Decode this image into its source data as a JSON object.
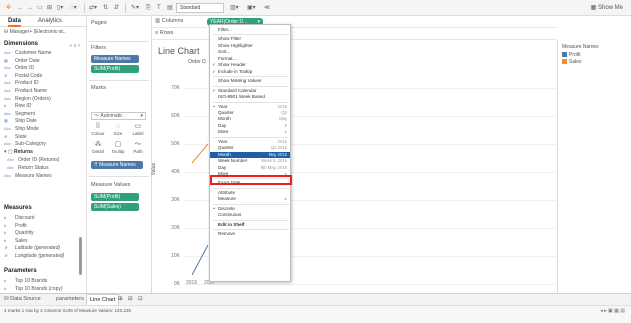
{
  "toolbar": {
    "select_value": "Standard",
    "show_me": "Show Me",
    "icons": [
      "tableau-logo-icon",
      "undo-icon",
      "redo-icon",
      "save-icon",
      "new-datasource-icon",
      "new-sheet-icon",
      "swap-icon",
      "sort-asc-icon",
      "sort-desc-icon",
      "highlight-icon",
      "group-icon",
      "label-icon",
      "fit-icon",
      "chart-icon",
      "share-icon",
      "show-me-icon"
    ]
  },
  "left_pane": {
    "tabs": [
      "Data",
      "Analytics"
    ],
    "datasource": "Manager+ (Electronic-st..",
    "dimensions_header": "Dimensions",
    "dimensions": [
      {
        "label": "Customer Name",
        "icon": "Abc"
      },
      {
        "label": "Order Date",
        "icon": "▦"
      },
      {
        "label": "Order ID",
        "icon": "Abc"
      },
      {
        "label": "Postal Code",
        "icon": "⊕"
      },
      {
        "label": "Product ID",
        "icon": "Abc"
      },
      {
        "label": "Product Name",
        "icon": "Abc"
      },
      {
        "label": "Region (Orders)",
        "icon": "Abc"
      },
      {
        "label": "Row ID",
        "icon": "#"
      },
      {
        "label": "Segment",
        "icon": "Abc"
      },
      {
        "label": "Ship Date",
        "icon": "▦"
      },
      {
        "label": "Ship Mode",
        "icon": "Abc"
      },
      {
        "label": "State",
        "icon": "⊕"
      },
      {
        "label": "Sub-Category",
        "icon": "Abc"
      }
    ],
    "returns_group": "Returns",
    "returns_fields": [
      {
        "label": "Order ID (Returns)",
        "icon": "Abc"
      },
      {
        "label": "Return Status",
        "icon": "Abc"
      }
    ],
    "measure_names": "Measure Names",
    "measures_header": "Measures",
    "measures": [
      {
        "label": "Discount",
        "icon": "#"
      },
      {
        "label": "Profit",
        "icon": "#"
      },
      {
        "label": "Quantity",
        "icon": "#"
      },
      {
        "label": "Sales",
        "icon": "#"
      },
      {
        "label": "Latitude (generated)",
        "icon": "⊕"
      },
      {
        "label": "Longitude (generated)",
        "icon": "⊕"
      }
    ],
    "parameters_header": "Parameters",
    "parameters": [
      {
        "label": "Top 10 Brands",
        "icon": "#"
      },
      {
        "label": "Top 10 Brands (copy)",
        "icon": "#"
      }
    ]
  },
  "cards": {
    "pages": "Pages",
    "filters": "Filters",
    "filter_pills": [
      "Measure Names",
      "SUM(Profit)"
    ],
    "marks": "Marks",
    "marks_type": "Automatic",
    "mark_buttons": [
      {
        "label": "Colour",
        "icon": "⠿"
      },
      {
        "label": "Size",
        "icon": "◌"
      },
      {
        "label": "Label",
        "icon": "▭"
      },
      {
        "label": "Detail",
        "icon": "⁂"
      },
      {
        "label": "Tooltip",
        "icon": "▢"
      },
      {
        "label": "Path",
        "icon": "〜"
      }
    ],
    "marks_pill": "Measure Names",
    "measure_values": "Measure Values",
    "mv_pills": [
      "SUM(Profit)",
      "SUM(Sales)"
    ]
  },
  "shelves": {
    "columns_label": "Columns",
    "columns_pill": "YEAR(Order D...",
    "rows_label": "Rows"
  },
  "view": {
    "title": "Line Chart",
    "column_header": "Order D",
    "y_axis_title": "Value",
    "y_ticks": [
      "70K",
      "60K",
      "50K",
      "40K",
      "30K",
      "20K",
      "10K",
      "0K"
    ],
    "x_ticks": [
      "2016",
      "2017"
    ]
  },
  "legend": {
    "title": "Measure Names",
    "items": [
      {
        "label": "Profit",
        "color": "#4e79a7"
      },
      {
        "label": "Sales",
        "color": "#f28e2b"
      }
    ]
  },
  "context_menu": {
    "items": [
      {
        "type": "item",
        "label": "Filter..."
      },
      {
        "type": "sep"
      },
      {
        "type": "item",
        "label": "Show Filter"
      },
      {
        "type": "item",
        "label": "Show Highlighter"
      },
      {
        "type": "item",
        "label": "Sort..."
      },
      {
        "type": "item",
        "label": "Format..."
      },
      {
        "type": "item",
        "label": "Show Header",
        "check": "✓"
      },
      {
        "type": "item",
        "label": "Include in Tooltip",
        "check": "✓"
      },
      {
        "type": "sep"
      },
      {
        "type": "item",
        "label": "Show Missing Values"
      },
      {
        "type": "sep"
      },
      {
        "type": "item",
        "label": "Standard Calendar",
        "check": "✓"
      },
      {
        "type": "item",
        "label": "ISO-8601 Week Based"
      },
      {
        "type": "sep"
      },
      {
        "type": "item",
        "label": "Year",
        "check": "•",
        "extra": "2015"
      },
      {
        "type": "item",
        "label": "Quarter",
        "extra": "Q2"
      },
      {
        "type": "item",
        "label": "Month",
        "extra": "May"
      },
      {
        "type": "item",
        "label": "Day",
        "extra": "8"
      },
      {
        "type": "item",
        "label": "More",
        "extra": "▸"
      },
      {
        "type": "sep"
      },
      {
        "type": "item",
        "label": "Year",
        "extra": "2015"
      },
      {
        "type": "item",
        "label": "Quarter",
        "extra": "Q2 2015"
      },
      {
        "type": "item",
        "label": "Month",
        "selected": true,
        "extra": "May 2015"
      },
      {
        "type": "item",
        "label": "Week Number",
        "extra": "Week 5, 2015"
      },
      {
        "type": "item",
        "label": "Day",
        "extra": "8th May, 2015"
      },
      {
        "type": "item",
        "label": "More",
        "extra": "▸"
      },
      {
        "type": "sep"
      },
      {
        "type": "item",
        "label": "Exact Date"
      },
      {
        "type": "sep"
      },
      {
        "type": "item",
        "label": "Attribute"
      },
      {
        "type": "item",
        "label": "Measure",
        "extra": "▸"
      },
      {
        "type": "sep"
      },
      {
        "type": "item",
        "label": "Discrete",
        "check": "•"
      },
      {
        "type": "item",
        "label": "Continuous"
      },
      {
        "type": "sep"
      },
      {
        "type": "item",
        "label": "Edit in Shelf",
        "bold": true
      },
      {
        "type": "sep"
      },
      {
        "type": "item",
        "label": "Remove"
      }
    ]
  },
  "bottom": {
    "data_source_tab": "Data Source",
    "sheet_tabs": [
      "parameters",
      "Line Chart"
    ],
    "status": "4 marks   1 row by 2 columns   SUM of Measure Values: 120,225"
  }
}
